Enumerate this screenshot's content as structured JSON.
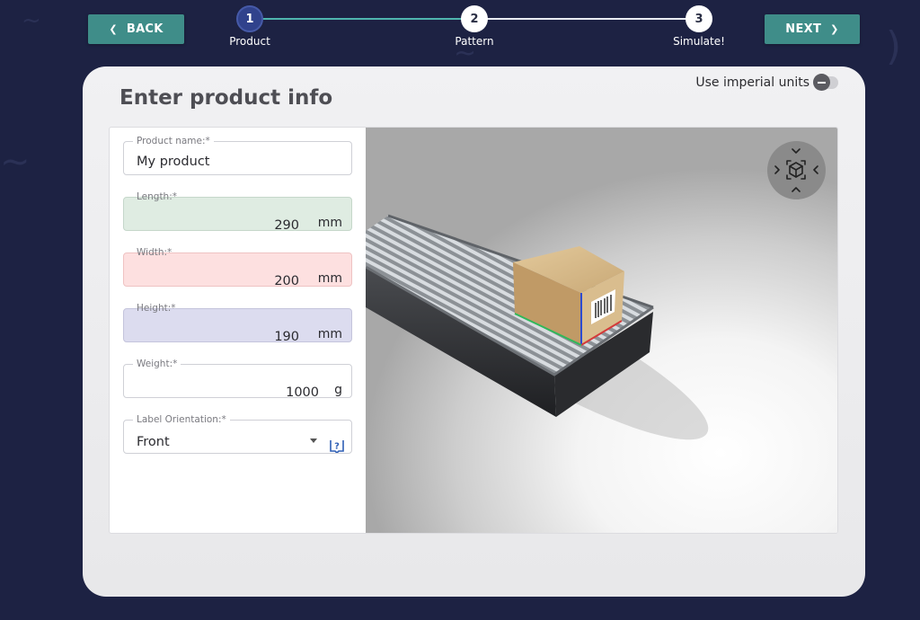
{
  "nav": {
    "back_label": "BACK",
    "next_label": "NEXT"
  },
  "stepper": {
    "steps": [
      {
        "number": "1",
        "label": "Product",
        "active": true
      },
      {
        "number": "2",
        "label": "Pattern",
        "active": false
      },
      {
        "number": "3",
        "label": "Simulate!",
        "active": false
      }
    ]
  },
  "card": {
    "title": "Enter product info",
    "imperial_label": "Use imperial units",
    "imperial_enabled": false
  },
  "form": {
    "product_name": {
      "label": "Product name:*",
      "value": "My product"
    },
    "length": {
      "label": "Length:*",
      "value": "290",
      "unit": "mm"
    },
    "width": {
      "label": "Width:*",
      "value": "200",
      "unit": "mm"
    },
    "height": {
      "label": "Height:*",
      "value": "190",
      "unit": "mm"
    },
    "weight": {
      "label": "Weight:*",
      "value": "1000",
      "unit": "g"
    },
    "label_orientation": {
      "label": "Label Orientation:*",
      "value": "Front"
    }
  },
  "colors": {
    "accent_teal": "#3f8d89",
    "step_active": "#30428c",
    "background": "#1d2243",
    "length_fill": "#dfece2",
    "width_fill": "#fde0e0",
    "height_fill": "#dcdcef"
  },
  "icons": {
    "back": "chevron-left-icon",
    "next": "chevron-right-icon",
    "toggle": "minus-icon",
    "help": "help-icon",
    "dropdown": "caret-down-icon",
    "view": "view-cube-icon"
  }
}
